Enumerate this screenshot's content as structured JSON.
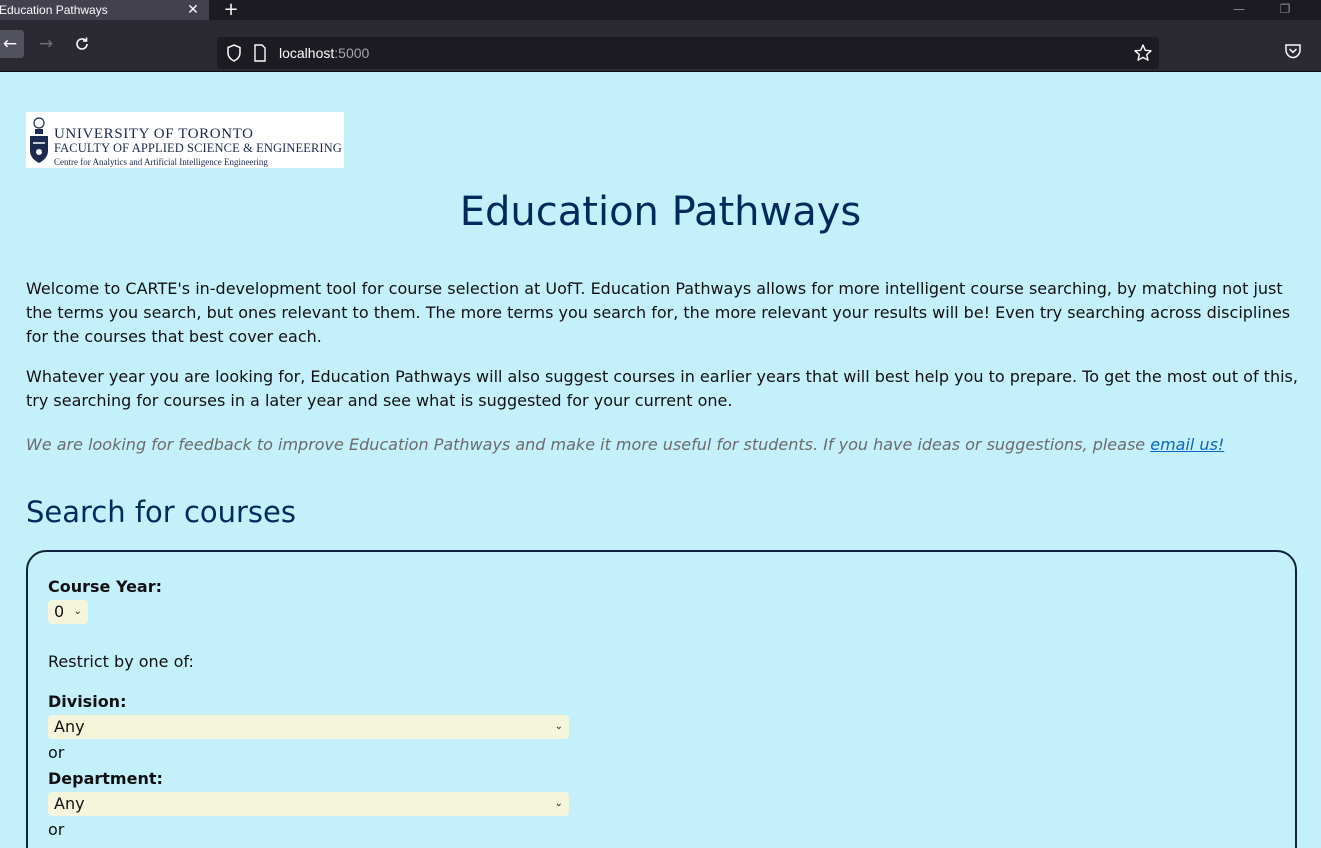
{
  "browser": {
    "tab_title": "Education Pathways",
    "url_host": "localhost",
    "url_port": ":5000"
  },
  "logo": {
    "line1": "UNIVERSITY OF TORONTO",
    "line2": "FACULTY OF APPLIED SCIENCE & ENGINEERING",
    "line3": "Centre for Analytics and Artificial Intelligence Engineering"
  },
  "page": {
    "title": "Education Pathways",
    "intro1": "Welcome to CARTE's in-development tool for course selection at UofT. Education Pathways allows for more intelligent course searching, by matching not just the terms you search, but ones relevant to them. The more terms you search for, the more relevant your results will be! Even try searching across disciplines for the courses that best cover each.",
    "intro2": "Whatever year you are looking for, Education Pathways will also suggest courses in earlier years that will best help you to prepare. To get the most out of this, try searching for courses in a later year and see what is suggested for your current one.",
    "feedback_text": "We are looking for feedback to improve Education Pathways and make it more useful for students. If you have ideas or suggestions, please ",
    "feedback_link": "email us!"
  },
  "search": {
    "heading": "Search for courses",
    "course_year_label": "Course Year:",
    "course_year_value": "0",
    "restrict_text": "Restrict by one of:",
    "division_label": "Division:",
    "division_value": "Any",
    "or1": "or",
    "department_label": "Department:",
    "department_value": "Any",
    "or2": "or"
  },
  "colors": {
    "page_bg": "#c4f0fc",
    "heading": "#002a5c",
    "select_bg": "#f5f5dc",
    "link": "#0a66c2"
  }
}
